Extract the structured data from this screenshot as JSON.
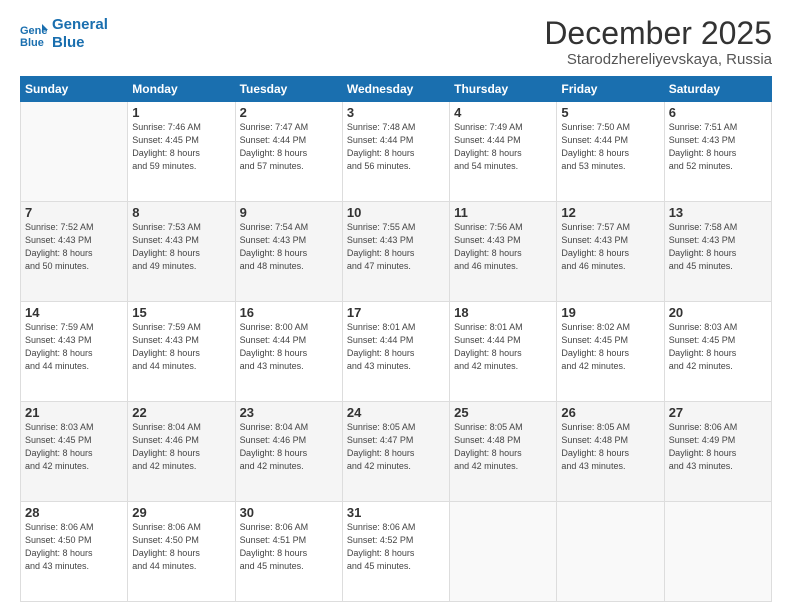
{
  "logo": {
    "line1": "General",
    "line2": "Blue"
  },
  "header": {
    "title": "December 2025",
    "subtitle": "Starodzhereliyevskaya, Russia"
  },
  "days_of_week": [
    "Sunday",
    "Monday",
    "Tuesday",
    "Wednesday",
    "Thursday",
    "Friday",
    "Saturday"
  ],
  "weeks": [
    [
      {
        "day": "",
        "info": ""
      },
      {
        "day": "1",
        "info": "Sunrise: 7:46 AM\nSunset: 4:45 PM\nDaylight: 8 hours\nand 59 minutes."
      },
      {
        "day": "2",
        "info": "Sunrise: 7:47 AM\nSunset: 4:44 PM\nDaylight: 8 hours\nand 57 minutes."
      },
      {
        "day": "3",
        "info": "Sunrise: 7:48 AM\nSunset: 4:44 PM\nDaylight: 8 hours\nand 56 minutes."
      },
      {
        "day": "4",
        "info": "Sunrise: 7:49 AM\nSunset: 4:44 PM\nDaylight: 8 hours\nand 54 minutes."
      },
      {
        "day": "5",
        "info": "Sunrise: 7:50 AM\nSunset: 4:44 PM\nDaylight: 8 hours\nand 53 minutes."
      },
      {
        "day": "6",
        "info": "Sunrise: 7:51 AM\nSunset: 4:43 PM\nDaylight: 8 hours\nand 52 minutes."
      }
    ],
    [
      {
        "day": "7",
        "info": "Sunrise: 7:52 AM\nSunset: 4:43 PM\nDaylight: 8 hours\nand 50 minutes."
      },
      {
        "day": "8",
        "info": "Sunrise: 7:53 AM\nSunset: 4:43 PM\nDaylight: 8 hours\nand 49 minutes."
      },
      {
        "day": "9",
        "info": "Sunrise: 7:54 AM\nSunset: 4:43 PM\nDaylight: 8 hours\nand 48 minutes."
      },
      {
        "day": "10",
        "info": "Sunrise: 7:55 AM\nSunset: 4:43 PM\nDaylight: 8 hours\nand 47 minutes."
      },
      {
        "day": "11",
        "info": "Sunrise: 7:56 AM\nSunset: 4:43 PM\nDaylight: 8 hours\nand 46 minutes."
      },
      {
        "day": "12",
        "info": "Sunrise: 7:57 AM\nSunset: 4:43 PM\nDaylight: 8 hours\nand 46 minutes."
      },
      {
        "day": "13",
        "info": "Sunrise: 7:58 AM\nSunset: 4:43 PM\nDaylight: 8 hours\nand 45 minutes."
      }
    ],
    [
      {
        "day": "14",
        "info": "Sunrise: 7:59 AM\nSunset: 4:43 PM\nDaylight: 8 hours\nand 44 minutes."
      },
      {
        "day": "15",
        "info": "Sunrise: 7:59 AM\nSunset: 4:43 PM\nDaylight: 8 hours\nand 44 minutes."
      },
      {
        "day": "16",
        "info": "Sunrise: 8:00 AM\nSunset: 4:44 PM\nDaylight: 8 hours\nand 43 minutes."
      },
      {
        "day": "17",
        "info": "Sunrise: 8:01 AM\nSunset: 4:44 PM\nDaylight: 8 hours\nand 43 minutes."
      },
      {
        "day": "18",
        "info": "Sunrise: 8:01 AM\nSunset: 4:44 PM\nDaylight: 8 hours\nand 42 minutes."
      },
      {
        "day": "19",
        "info": "Sunrise: 8:02 AM\nSunset: 4:45 PM\nDaylight: 8 hours\nand 42 minutes."
      },
      {
        "day": "20",
        "info": "Sunrise: 8:03 AM\nSunset: 4:45 PM\nDaylight: 8 hours\nand 42 minutes."
      }
    ],
    [
      {
        "day": "21",
        "info": "Sunrise: 8:03 AM\nSunset: 4:45 PM\nDaylight: 8 hours\nand 42 minutes."
      },
      {
        "day": "22",
        "info": "Sunrise: 8:04 AM\nSunset: 4:46 PM\nDaylight: 8 hours\nand 42 minutes."
      },
      {
        "day": "23",
        "info": "Sunrise: 8:04 AM\nSunset: 4:46 PM\nDaylight: 8 hours\nand 42 minutes."
      },
      {
        "day": "24",
        "info": "Sunrise: 8:05 AM\nSunset: 4:47 PM\nDaylight: 8 hours\nand 42 minutes."
      },
      {
        "day": "25",
        "info": "Sunrise: 8:05 AM\nSunset: 4:48 PM\nDaylight: 8 hours\nand 42 minutes."
      },
      {
        "day": "26",
        "info": "Sunrise: 8:05 AM\nSunset: 4:48 PM\nDaylight: 8 hours\nand 43 minutes."
      },
      {
        "day": "27",
        "info": "Sunrise: 8:06 AM\nSunset: 4:49 PM\nDaylight: 8 hours\nand 43 minutes."
      }
    ],
    [
      {
        "day": "28",
        "info": "Sunrise: 8:06 AM\nSunset: 4:50 PM\nDaylight: 8 hours\nand 43 minutes."
      },
      {
        "day": "29",
        "info": "Sunrise: 8:06 AM\nSunset: 4:50 PM\nDaylight: 8 hours\nand 44 minutes."
      },
      {
        "day": "30",
        "info": "Sunrise: 8:06 AM\nSunset: 4:51 PM\nDaylight: 8 hours\nand 45 minutes."
      },
      {
        "day": "31",
        "info": "Sunrise: 8:06 AM\nSunset: 4:52 PM\nDaylight: 8 hours\nand 45 minutes."
      },
      {
        "day": "",
        "info": ""
      },
      {
        "day": "",
        "info": ""
      },
      {
        "day": "",
        "info": ""
      }
    ]
  ]
}
